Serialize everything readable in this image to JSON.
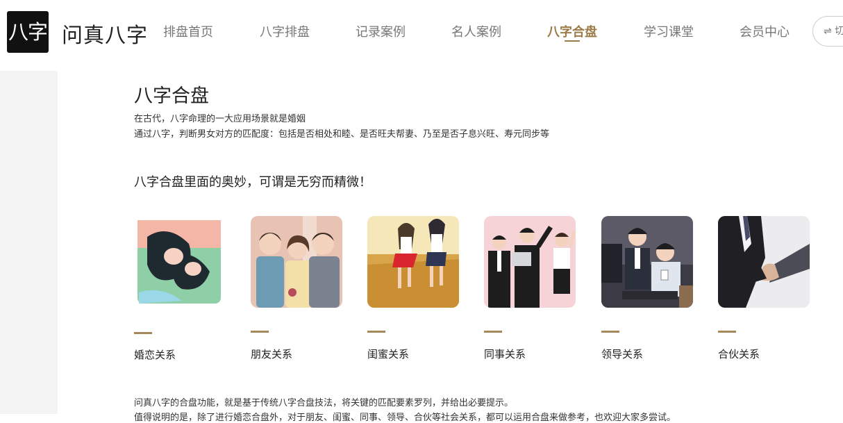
{
  "header": {
    "logo_text": "八字",
    "brand": "问真八字",
    "nav": [
      "排盘首页",
      "八字排盘",
      "记录案例",
      "名人案例",
      "八字合盘",
      "学习课堂",
      "会员中心"
    ],
    "active_nav": "八字合盘",
    "switch_label": "⇌ 切"
  },
  "main": {
    "title": "八字合盘",
    "desc": [
      "在古代，八字命理的一大应用场景就是婚姻",
      "通过八字，判断男女对方的匹配度：包括是否相处和睦、是否旺夫帮妻、乃至是否子息兴旺、寿元同步等"
    ],
    "tagline": "八字合盘里面的奥妙，可谓是无穷而精微！",
    "cards": [
      {
        "label": "婚恋关系"
      },
      {
        "label": "朋友关系"
      },
      {
        "label": "闺蜜关系"
      },
      {
        "label": "同事关系"
      },
      {
        "label": "领导关系"
      },
      {
        "label": "合伙关系"
      }
    ],
    "bottom": [
      "问真八字的合盘功能，就是基于传统八字合盘技法，将关键的匹配要素罗列，并给出必要提示。",
      "值得说明的是，除了进行婚恋合盘外，对于朋友、闺蜜、同事、领导、合伙等社会关系，都可以运用合盘来做参考，也欢迎大家多尝试。"
    ]
  },
  "colors": {
    "accent": "#9b7b4a",
    "bar": "#a6875a"
  }
}
